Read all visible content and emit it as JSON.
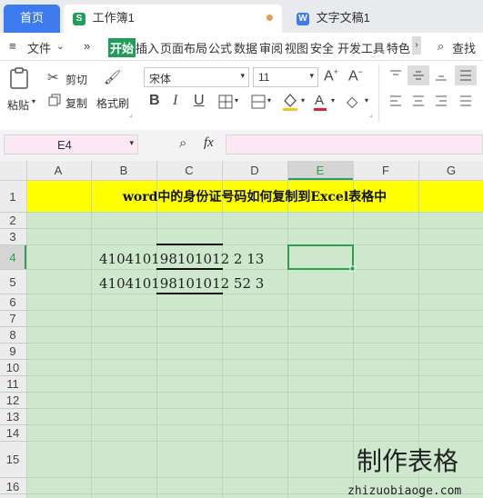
{
  "tabs": {
    "home": "首页",
    "sheet": "工作簿1",
    "doc": "文字文稿1"
  },
  "menubar": {
    "menu_icon": "≡",
    "file": "文件",
    "more": "»",
    "items": [
      "开始",
      "插入",
      "页面布局",
      "公式",
      "数据",
      "审阅",
      "视图",
      "安全",
      "开发工具",
      "特色"
    ],
    "search": "查找"
  },
  "ribbon": {
    "paste": "粘贴",
    "cut": "剪切",
    "copy": "复制",
    "format_painter": "格式刷",
    "font_name": "宋体",
    "font_size": "11",
    "font_color": "#e0212a",
    "fill_color": "#f5c518"
  },
  "formula_bar": {
    "name_box": "E4",
    "fx": "fx",
    "formula": ""
  },
  "sheet": {
    "columns": [
      "A",
      "B",
      "C",
      "D",
      "E",
      "F",
      "G"
    ],
    "rows": [
      "1",
      "2",
      "3",
      "4",
      "5",
      "6",
      "7",
      "8",
      "9",
      "10",
      "11",
      "12",
      "13",
      "14",
      "15",
      "16"
    ],
    "title": "word中的身份证号码如何复制到Excel表格中",
    "title_bg": "#ffff00",
    "grid_bg": "#cde8cd",
    "active_cell": "E4",
    "row4_text": "410410198101012 2 13",
    "row5_text": "410410198101012 52 3"
  },
  "watermark": {
    "title": "制作表格",
    "url": "zhizuobiaoge.com"
  }
}
